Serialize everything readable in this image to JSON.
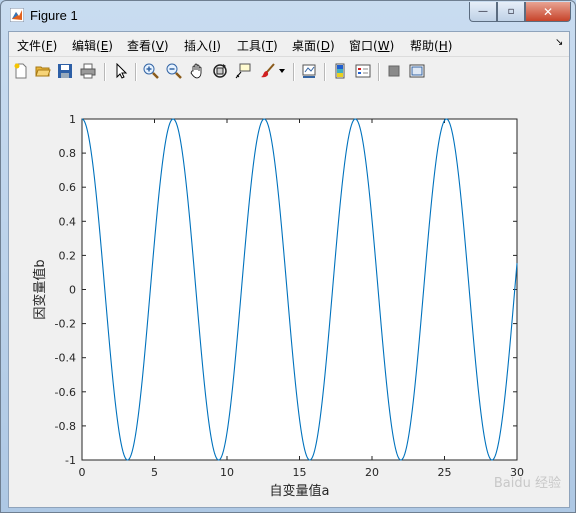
{
  "window": {
    "title": "Figure 1"
  },
  "caption_buttons": {
    "minimize": "—",
    "maximize": "▫",
    "close": "✕"
  },
  "menu": [
    {
      "label": "文件(",
      "key": "F",
      "end": ")"
    },
    {
      "label": "编辑(",
      "key": "E",
      "end": ")"
    },
    {
      "label": "查看(",
      "key": "V",
      "end": ")"
    },
    {
      "label": "插入(",
      "key": "I",
      "end": ")"
    },
    {
      "label": "工具(",
      "key": "T",
      "end": ")"
    },
    {
      "label": "桌面(",
      "key": "D",
      "end": ")"
    },
    {
      "label": "窗口(",
      "key": "W",
      "end": ")"
    },
    {
      "label": "帮助(",
      "key": "H",
      "end": ")"
    }
  ],
  "menu_overflow": "↘",
  "toolbar": [
    "new-figure-icon",
    "open-file-icon",
    "save-icon",
    "print-icon",
    "pointer-icon",
    "zoom-in-icon",
    "zoom-out-icon",
    "pan-hand-icon",
    "rotate-3d-icon",
    "data-cursor-icon",
    "brush-icon",
    "brush-dropdown-icon",
    "link-plot-icon",
    "colorbar-icon",
    "legend-icon",
    "hide-plot-tools-icon",
    "show-plot-tools-icon"
  ],
  "chart_data": {
    "type": "line",
    "title": "",
    "xlabel": "自变量值a",
    "ylabel": "因变量值b",
    "xlim": [
      0,
      30
    ],
    "ylim": [
      -1,
      1
    ],
    "xticks": [
      "0",
      "5",
      "10",
      "15",
      "20",
      "25",
      "30"
    ],
    "yticks": [
      "-1",
      "-0.8",
      "-0.6",
      "-0.4",
      "-0.2",
      "0",
      "0.2",
      "0.4",
      "0.6",
      "0.8",
      "1"
    ],
    "series": [
      {
        "function": "cos",
        "x_range": [
          0,
          30
        ],
        "color": "#0072bd"
      }
    ],
    "grid": false
  },
  "watermark": "Baidu 经验"
}
